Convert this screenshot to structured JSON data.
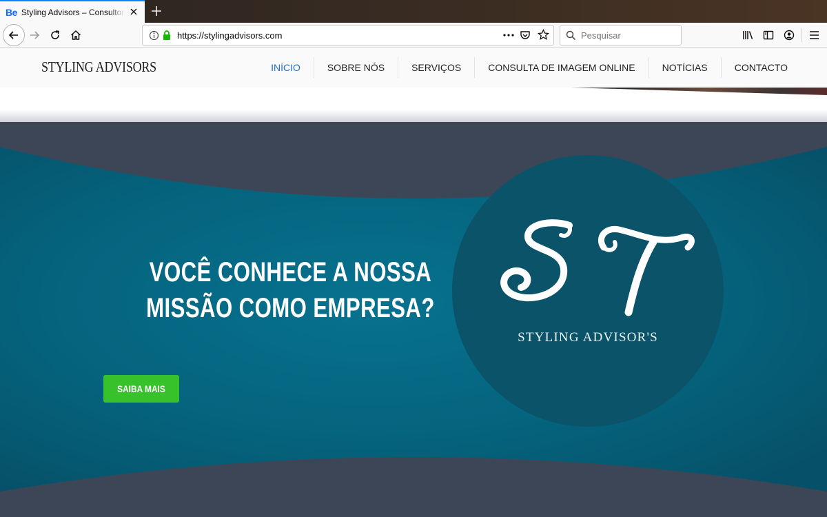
{
  "browser": {
    "tab": {
      "favicon_text": "Be",
      "title": "Styling Advisors – Consultores de Imagem"
    },
    "url": "https://stylingadvisors.com",
    "search": {
      "placeholder": "Pesquisar"
    },
    "icons": [
      "back-icon",
      "forward-icon",
      "reload-icon",
      "home-icon",
      "info-icon",
      "lock-icon",
      "more-icon",
      "pocket-icon",
      "star-icon",
      "search-icon",
      "library-icon",
      "sidebar-icon",
      "account-icon",
      "menu-icon",
      "close-icon",
      "new-tab-icon"
    ]
  },
  "site": {
    "logo": "STYLING ADVISORS",
    "nav": [
      {
        "label": "INÍCIO",
        "active": true
      },
      {
        "label": "SOBRE NÓS",
        "active": false
      },
      {
        "label": "SERVIÇOS",
        "active": false
      },
      {
        "label": "CONSULTA DE IMAGEM ONLINE",
        "active": false
      },
      {
        "label": "NOTÍCIAS",
        "active": false
      },
      {
        "label": "CONTACTO",
        "active": false
      }
    ]
  },
  "hero": {
    "heading_line1": "VOCÊ CONHECE A NOSSA",
    "heading_line2": "MISSÃO COMO EMPRESA?",
    "cta_label": "SAIBA MAIS",
    "brand_monogram": "ST",
    "brand_caption": "STYLING ADVISOR'S"
  },
  "colors": {
    "accent_link": "#1e73be",
    "cta_green": "#37c22b",
    "hero_teal": "#0d6f8c",
    "circle_teal": "#0a5369",
    "dark_slate": "#3d4657"
  }
}
